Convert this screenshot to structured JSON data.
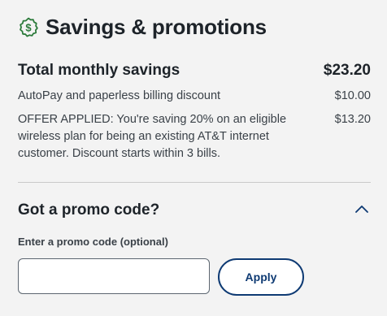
{
  "header": {
    "icon": "dollar-badge-icon",
    "title": "Savings & promotions",
    "icon_color": "#2b7a3a"
  },
  "summary": {
    "total_label": "Total monthly savings",
    "total_value": "$23.20"
  },
  "items": [
    {
      "description": "AutoPay and paperless billing discount",
      "amount": "$10.00"
    },
    {
      "description": "OFFER APPLIED: You're saving 20% on an eligible wireless plan for being an existing AT&T internet customer. Discount starts within 3 bills.",
      "amount": "$13.20"
    }
  ],
  "promo": {
    "title": "Got a promo code?",
    "toggle_icon": "chevron-up-icon",
    "field_label": "Enter a promo code (optional)",
    "input_value": "",
    "apply_label": "Apply",
    "accent_color": "#0e3a73"
  }
}
